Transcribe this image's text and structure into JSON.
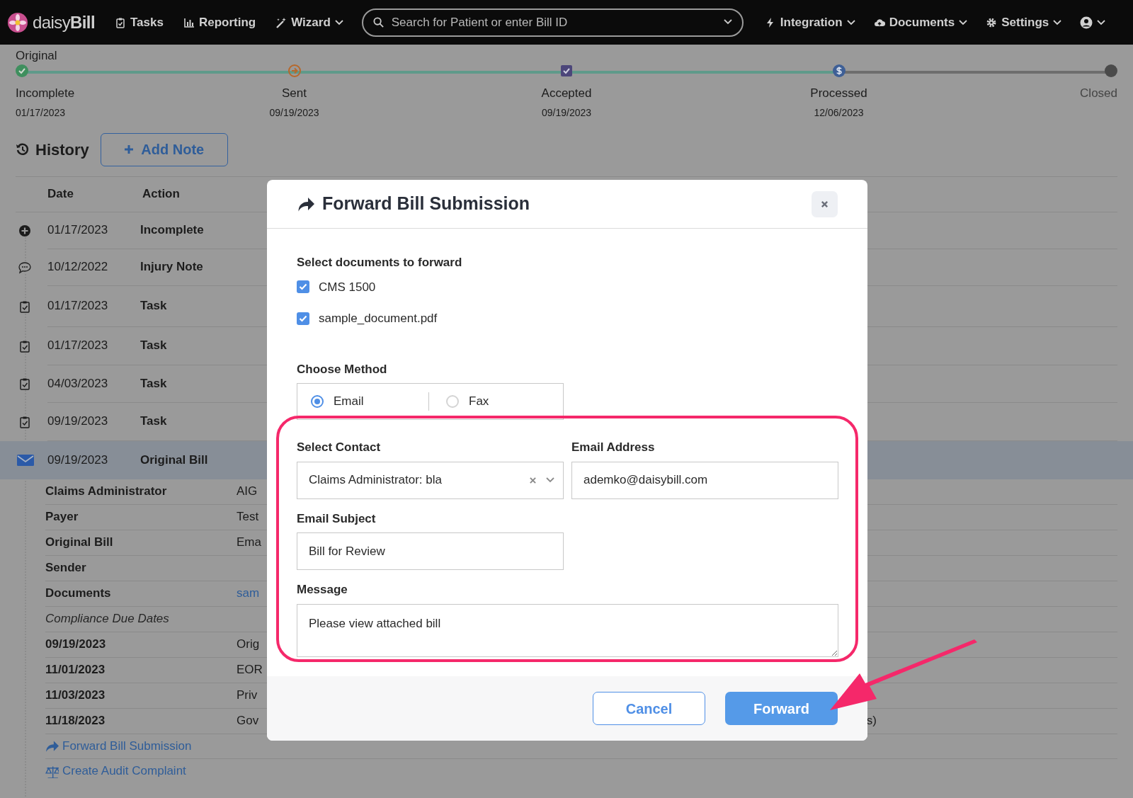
{
  "nav": {
    "logo": "daisy**Bill**",
    "items": [
      {
        "label": "Tasks",
        "dropdown": false
      },
      {
        "label": "Reporting",
        "dropdown": false
      },
      {
        "label": "Wizard",
        "dropdown": true
      }
    ],
    "search": {
      "placeholder": "Search for Patient or enter Bill ID"
    },
    "right_items": [
      {
        "label": "Integration",
        "dropdown": true
      },
      {
        "label": "Documents",
        "dropdown": true
      },
      {
        "label": "Settings",
        "dropdown": true
      }
    ]
  },
  "progress": {
    "label": "Original",
    "steps": [
      {
        "kind": "check",
        "label": "Incomplete",
        "date": "01/17/2023",
        "reached": true,
        "color": "#3f8f5e"
      },
      {
        "kind": "arrow",
        "label": "Sent",
        "date": "09/19/2023",
        "reached": true,
        "color": "#b7682a"
      },
      {
        "kind": "box",
        "label": "Accepted",
        "date": "09/19/2023",
        "reached": true,
        "color": "#4c467a"
      },
      {
        "kind": "dollar",
        "label": "Processed",
        "date": "12/06/2023",
        "reached": true,
        "color": "#3e5f96"
      },
      {
        "kind": "dot",
        "label": "Closed",
        "reached": false,
        "color": "#4a4a4a"
      }
    ]
  },
  "history": {
    "title": "History",
    "add_note": "Add Note",
    "columns": [
      "Date",
      "Action"
    ],
    "rows": [
      {
        "kind": "created",
        "date": "01/17/2023",
        "action": "Incomplete",
        "selected": false
      },
      {
        "kind": "note",
        "date": "10/12/2022",
        "action": "Injury Note",
        "selected": false
      },
      {
        "kind": "task",
        "date": "01/17/2023",
        "action": "Task",
        "selected": false
      },
      {
        "kind": "task",
        "date": "01/17/2023",
        "action": "Task",
        "selected": false
      },
      {
        "kind": "task",
        "date": "04/03/2023",
        "action": "Task",
        "selected": false
      },
      {
        "kind": "task",
        "date": "09/19/2023",
        "action": "Task",
        "selected": false
      },
      {
        "kind": "bill",
        "date": "09/19/2023",
        "action": "Original Bill",
        "selected": true
      }
    ],
    "details": [
      {
        "kind": "field",
        "label": "Claims Administrator",
        "value": "AIG"
      },
      {
        "kind": "field",
        "label": "Payer",
        "value": "Test"
      },
      {
        "kind": "field",
        "label": "Original Bill",
        "value": "Ema"
      },
      {
        "kind": "field",
        "label": "Sender"
      },
      {
        "kind": "link",
        "label": "Documents",
        "value": "sam"
      },
      {
        "kind": "heading",
        "label": "Compliance Due Dates"
      },
      {
        "kind": "field",
        "label": "09/19/2023",
        "value": "Orig"
      },
      {
        "kind": "field",
        "label": "11/01/2023",
        "value": "EOR"
      },
      {
        "kind": "field",
        "label": "11/03/2023",
        "value": "Priv"
      },
      {
        "kind": "field",
        "label": "11/18/2023",
        "value": "Gov",
        "tail": "s)"
      }
    ],
    "actions": [
      {
        "label": "Forward Bill Submission"
      },
      {
        "label": "Create Audit Complaint"
      }
    ]
  },
  "modal": {
    "title": "Forward Bill Submission",
    "documents_label": "Select documents to forward",
    "documents": [
      {
        "label": "CMS 1500",
        "checked": true
      },
      {
        "label": "sample_document.pdf",
        "checked": true
      }
    ],
    "method_label": "Choose Method",
    "methods": [
      {
        "label": "Email",
        "selected": true
      },
      {
        "label": "Fax",
        "selected": false
      }
    ],
    "contact_label": "Select Contact",
    "contact_value": "Claims Administrator: bla",
    "email_label": "Email Address",
    "email_value": "ademko@daisybill.com",
    "subject_label": "Email Subject",
    "subject_value": "Bill for Review",
    "message_label": "Message",
    "message_value": "Please view attached bill",
    "cancel": "Cancel",
    "forward": "Forward"
  }
}
